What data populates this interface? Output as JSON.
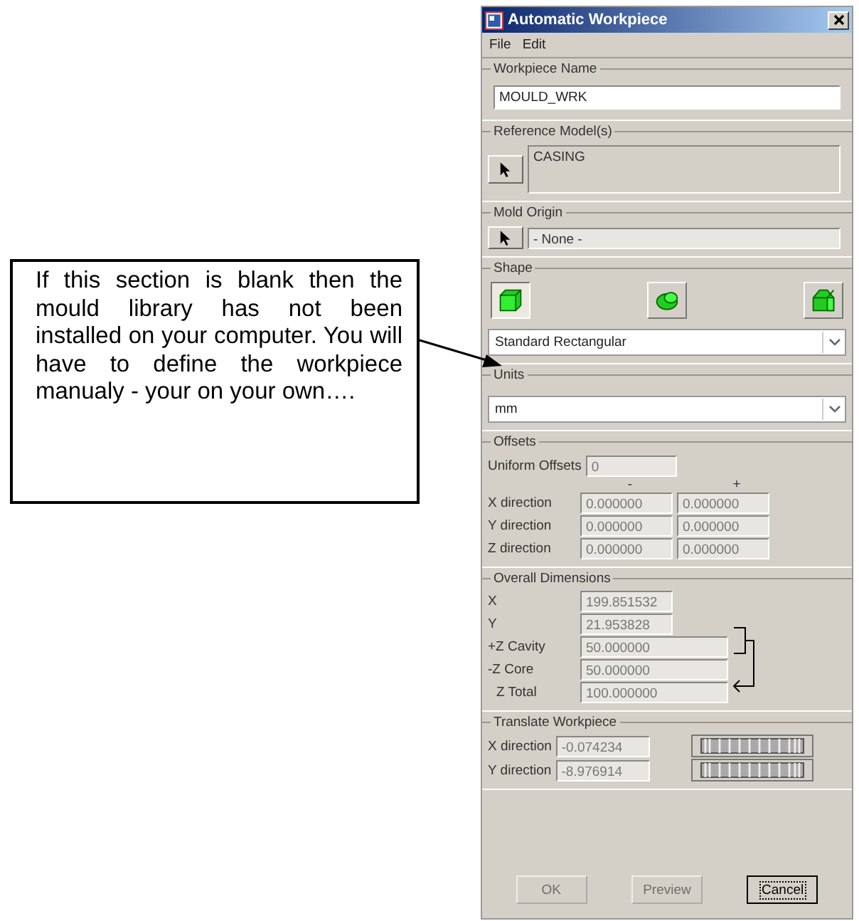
{
  "callout": {
    "text": "If this section is blank then the mould library has not been installed on your computer. You will have to define the workpiece manualy - your on your own…."
  },
  "window": {
    "title": "Automatic Workpiece"
  },
  "menu": [
    "File",
    "Edit"
  ],
  "workpiece_name": {
    "label": "Workpiece Name",
    "value": "MOULD_WRK"
  },
  "reference_models": {
    "label": "Reference Model(s)",
    "items": [
      "CASING"
    ]
  },
  "mold_origin": {
    "label": "Mold Origin",
    "value": "- None -"
  },
  "shape": {
    "label": "Shape",
    "value": "Standard Rectangular",
    "options": [
      {
        "kind": "box",
        "selected": true
      },
      {
        "kind": "cylinder",
        "selected": false
      },
      {
        "kind": "prism",
        "selected": false
      }
    ]
  },
  "units": {
    "label": "Units",
    "value": "mm"
  },
  "offsets": {
    "label": "Offsets",
    "uniform_label": "Uniform Offsets",
    "uniform_value": "0",
    "minus_header": "-",
    "plus_header": "+",
    "rows": [
      {
        "label": "X direction",
        "minus": "0.000000",
        "plus": "0.000000"
      },
      {
        "label": "Y direction",
        "minus": "0.000000",
        "plus": "0.000000"
      },
      {
        "label": "Z direction",
        "minus": "0.000000",
        "plus": "0.000000"
      }
    ]
  },
  "overall_dimensions": {
    "label": "Overall Dimensions",
    "rows": [
      {
        "label": "X",
        "value": "199.851532",
        "kind": "planar"
      },
      {
        "label": "Y",
        "value": "21.953828",
        "kind": "planar"
      },
      {
        "label": "+Z Cavity",
        "value": "50.000000",
        "kind": "depth"
      },
      {
        "label": "-Z Core",
        "value": "50.000000",
        "kind": "depth"
      },
      {
        "label": "Z Total",
        "value": "100.000000",
        "kind": "total"
      }
    ]
  },
  "translate": {
    "label": "Translate Workpiece",
    "rows": [
      {
        "label": "X direction",
        "value": "-0.074234"
      },
      {
        "label": "Y direction",
        "value": "-8.976914"
      }
    ]
  },
  "buttons": [
    {
      "label": "OK",
      "disabled": true,
      "focused": false
    },
    {
      "label": "Preview",
      "disabled": true,
      "focused": false
    },
    {
      "label": "Cancel",
      "disabled": false,
      "focused": true
    }
  ]
}
